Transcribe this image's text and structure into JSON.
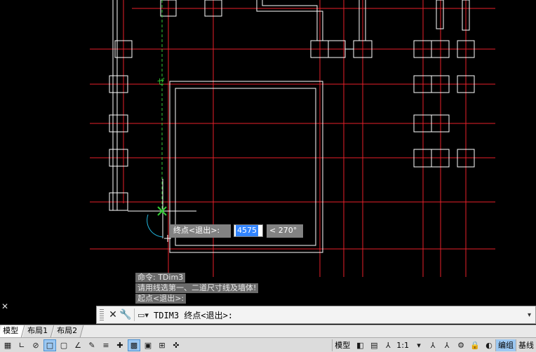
{
  "command_prompt": {
    "label": "终点<退出>:",
    "value": "4575",
    "angle": "< 270°"
  },
  "history": [
    "命令: TDim3",
    "请用线选第一、二道尺寸线及墙体!",
    "起点<退出>:"
  ],
  "command_line": {
    "text": "TDIM3 终点<退出>:"
  },
  "layout_tabs": [
    "模型",
    "布局1",
    "布局2"
  ],
  "status_bar": {
    "model_label": "模型",
    "scale_label": "1:1",
    "group_label": "编组",
    "baseline_label": "基线"
  },
  "colors": {
    "grid_red": "#e8202a",
    "wall_white": "#ffffff",
    "green_marker": "#33cc33",
    "cyan_arc": "#22b8e0"
  }
}
